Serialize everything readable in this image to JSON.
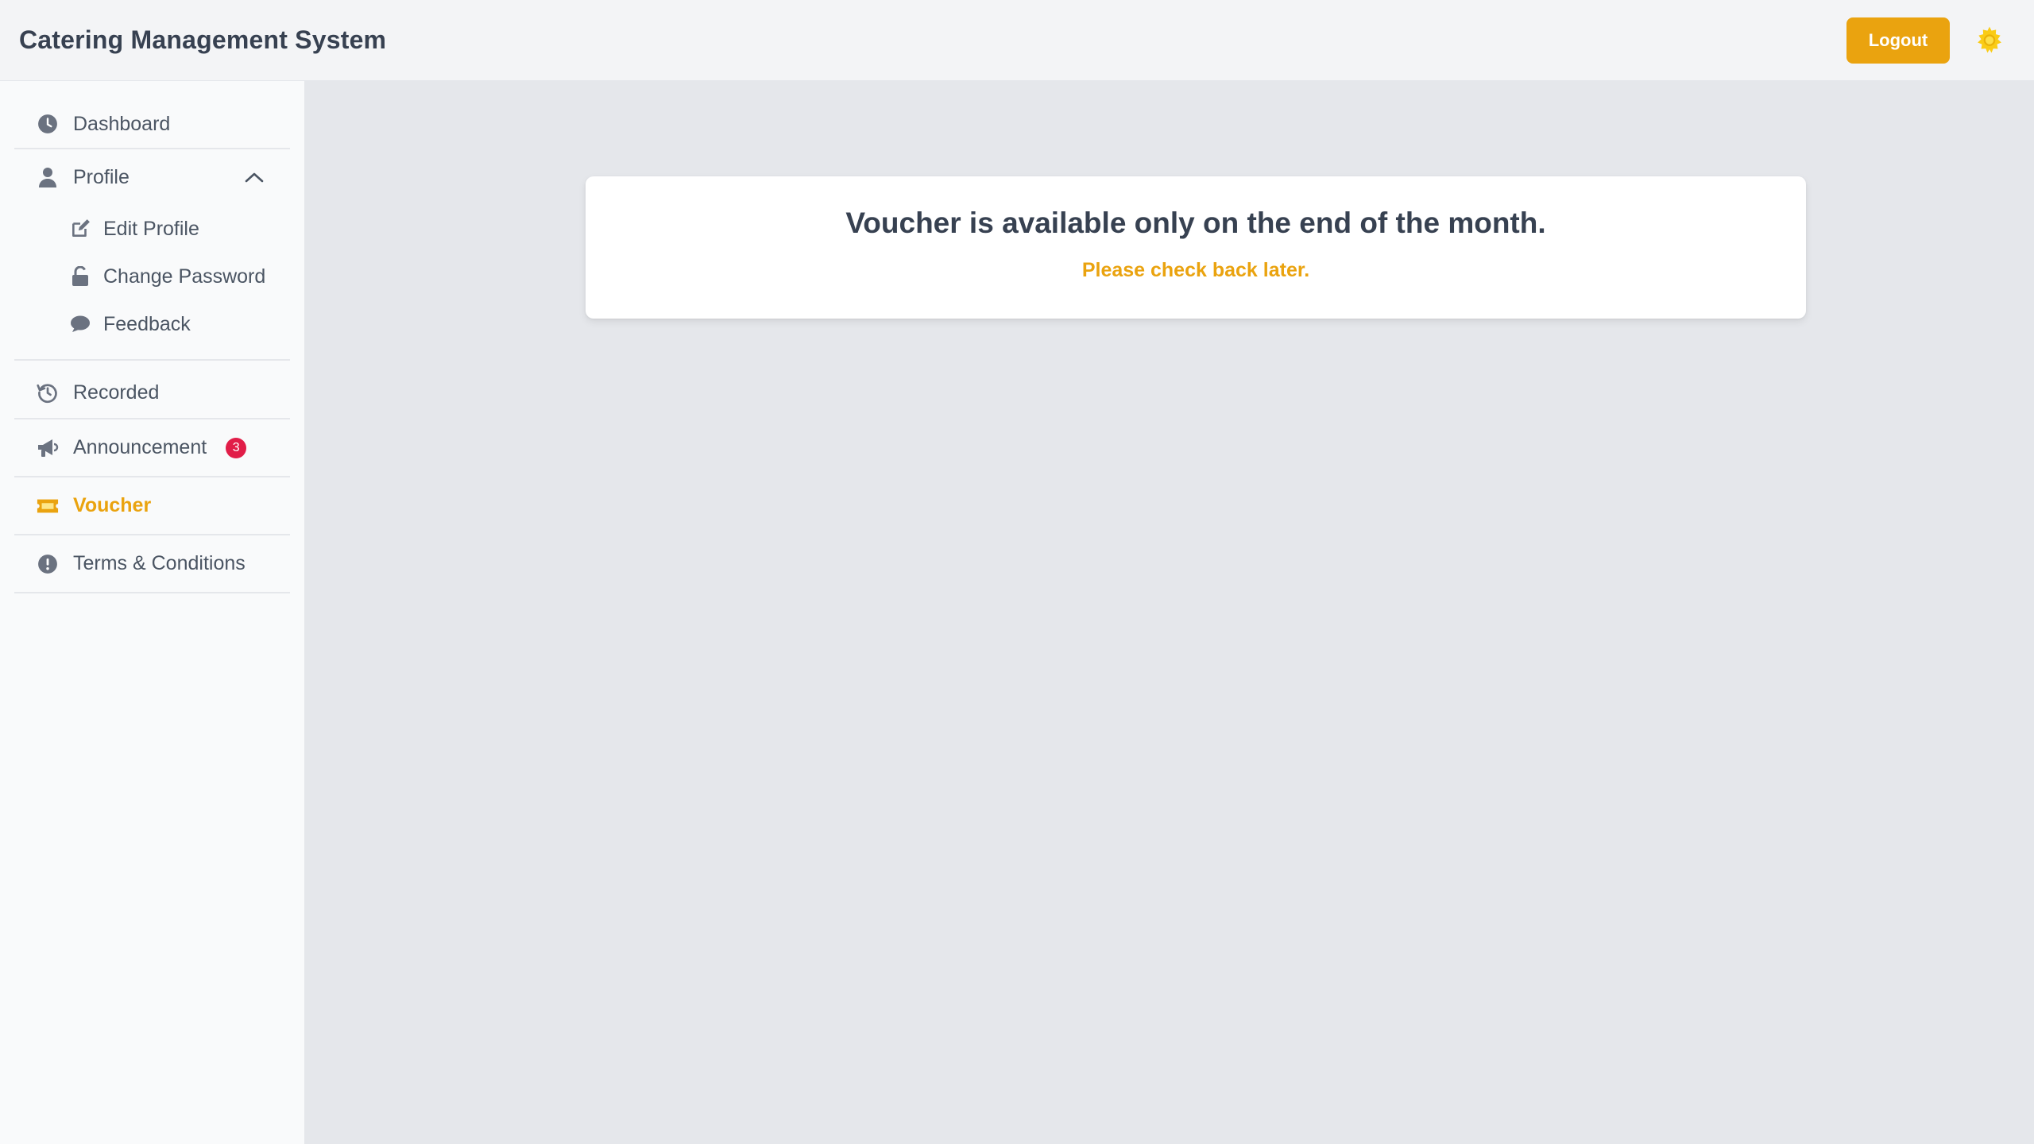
{
  "app": {
    "title": "Catering Management System"
  },
  "header": {
    "logout_label": "Logout",
    "theme_icon": "sun-icon"
  },
  "sidebar": {
    "dashboard": {
      "label": "Dashboard",
      "icon": "clock-icon"
    },
    "profile": {
      "label": "Profile",
      "icon": "user-icon",
      "expanded": true,
      "items": [
        {
          "label": "Edit Profile",
          "icon": "edit-icon"
        },
        {
          "label": "Change Password",
          "icon": "unlock-icon"
        },
        {
          "label": "Feedback",
          "icon": "comment-icon"
        }
      ]
    },
    "recorded": {
      "label": "Recorded",
      "icon": "history-icon"
    },
    "announcement": {
      "label": "Announcement",
      "icon": "megaphone-icon",
      "badge": "3"
    },
    "voucher": {
      "label": "Voucher",
      "icon": "ticket-icon",
      "active": true
    },
    "terms": {
      "label": "Terms & Conditions",
      "icon": "exclamation-circle-icon"
    }
  },
  "main": {
    "message_title": "Voucher is available only on the end of the month.",
    "message_sub": "Please check back later."
  },
  "colors": {
    "accent": "#eaa30f",
    "text": "#374151",
    "muted": "#4b5563",
    "badge": "#e11d48",
    "background": "#e5e7eb",
    "sidebar_bg": "#f9fafb"
  }
}
